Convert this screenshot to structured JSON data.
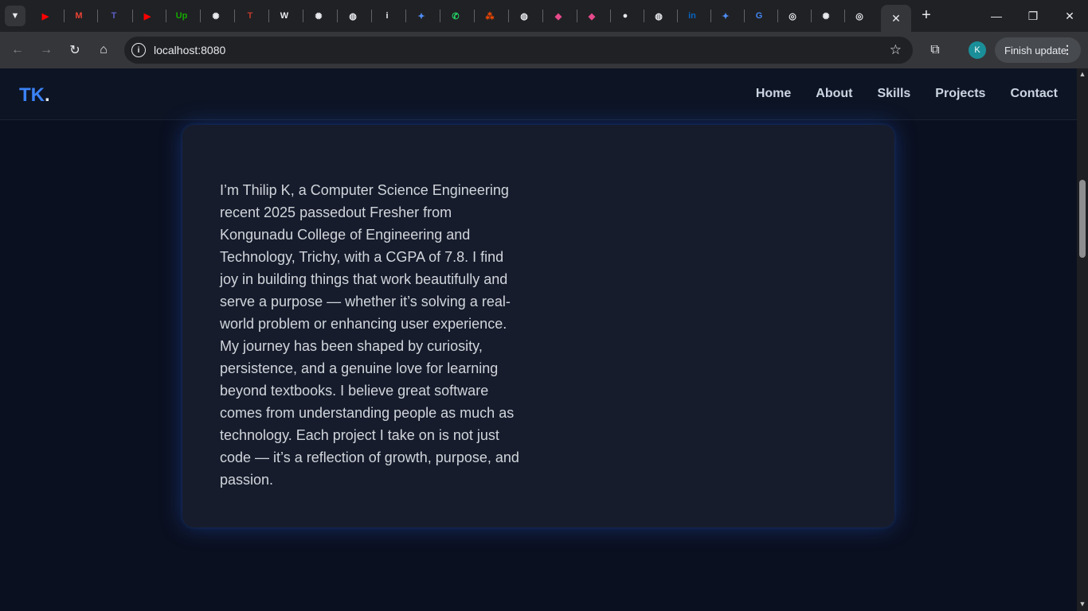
{
  "browser": {
    "tab_menu_icon": "chevron-down-icon",
    "tab_favicons": [
      {
        "name": "youtube-icon",
        "glyph": "▶",
        "color": "#ff0000"
      },
      {
        "name": "gmail-icon",
        "glyph": "M",
        "color": "#ea4335"
      },
      {
        "name": "teams-icon",
        "glyph": "T",
        "color": "#5b5fc7"
      },
      {
        "name": "youtube-icon",
        "glyph": "▶",
        "color": "#ff0000"
      },
      {
        "name": "upwork-icon",
        "glyph": "Up",
        "color": "#14a800"
      },
      {
        "name": "chatgpt-icon",
        "glyph": "✺",
        "color": "#e8eaed"
      },
      {
        "name": "t-logo-icon",
        "glyph": "T",
        "color": "#c0392b"
      },
      {
        "name": "wikipedia-icon",
        "glyph": "W",
        "color": "#e8eaed"
      },
      {
        "name": "chatgpt-icon",
        "glyph": "✺",
        "color": "#e8eaed"
      },
      {
        "name": "globe-icon",
        "glyph": "◍",
        "color": "#e8eaed"
      },
      {
        "name": "info-icon",
        "glyph": "i",
        "color": "#e8eaed"
      },
      {
        "name": "gemini-icon",
        "glyph": "✦",
        "color": "#4f8df5"
      },
      {
        "name": "whatsapp-icon",
        "glyph": "✆",
        "color": "#25d366"
      },
      {
        "name": "zapier-icon",
        "glyph": "⁂",
        "color": "#ff4a00"
      },
      {
        "name": "globe-icon",
        "glyph": "◍",
        "color": "#e8eaed"
      },
      {
        "name": "claude-icon",
        "glyph": "◆",
        "color": "#e64a8b"
      },
      {
        "name": "claude-icon",
        "glyph": "◆",
        "color": "#e64a8b"
      },
      {
        "name": "github-icon",
        "glyph": "●",
        "color": "#e8eaed"
      },
      {
        "name": "globe-icon",
        "glyph": "◍",
        "color": "#e8eaed"
      },
      {
        "name": "linkedin-icon",
        "glyph": "in",
        "color": "#0a66c2"
      },
      {
        "name": "gemini-icon",
        "glyph": "✦",
        "color": "#4f8df5"
      },
      {
        "name": "google-icon",
        "glyph": "G",
        "color": "#4285f4"
      },
      {
        "name": "chrome-icon",
        "glyph": "◎",
        "color": "#e8eaed"
      },
      {
        "name": "chatgpt-icon",
        "glyph": "✺",
        "color": "#e8eaed"
      },
      {
        "name": "chrome-icon",
        "glyph": "◎",
        "color": "#e8eaed"
      }
    ],
    "active_tab_close": "✕",
    "new_tab": "+",
    "window_controls": {
      "minimize": "—",
      "restore": "❐",
      "close": "✕"
    },
    "toolbar": {
      "back": "←",
      "forward": "→",
      "reload": "↻",
      "home": "⌂",
      "url": "localhost:8080",
      "star": "☆",
      "extensions": "⧉",
      "profile_initial": "K",
      "finish_update_label": "Finish update",
      "menu_dots": "⋮"
    }
  },
  "site": {
    "logo": {
      "text": "TK",
      "dot": "."
    },
    "nav": [
      "Home",
      "About",
      "Skills",
      "Projects",
      "Contact"
    ],
    "about": {
      "paragraph": "I’m Thilip K, a Computer Science Engineering recent 2025 passedout Fresher from Kongunadu College of Engineering and Technology, Trichy, with a CGPA of 7.8. I find joy in building things that work beautifully and serve a purpose — whether it’s solving a real-world problem or enhancing user experience. My journey has been shaped by curiosity, persistence, and a genuine love for learning beyond textbooks. I believe great software comes from understanding people as much as technology. Each project I take on is not just code — it’s a reflection of growth, purpose, and passion."
    }
  },
  "scrollbar": {
    "up": "▲",
    "down": "▼"
  },
  "colors": {
    "accent": "#3b82f6",
    "background": "#0b1020",
    "card": "#161c2c"
  }
}
